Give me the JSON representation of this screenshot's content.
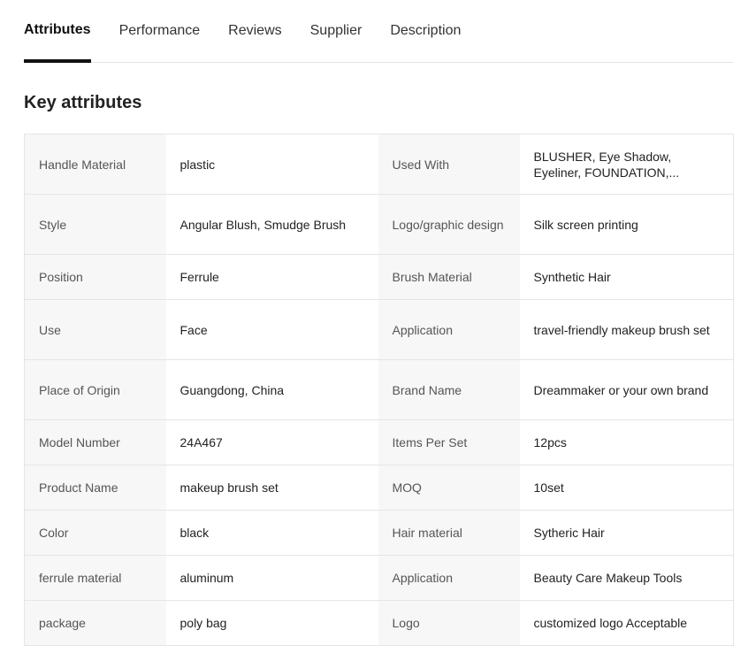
{
  "tabs": [
    {
      "label": "Attributes",
      "active": true
    },
    {
      "label": "Performance",
      "active": false
    },
    {
      "label": "Reviews",
      "active": false
    },
    {
      "label": "Supplier",
      "active": false
    },
    {
      "label": "Description",
      "active": false
    }
  ],
  "section_title": "Key attributes",
  "attributes": [
    {
      "k1": "Handle Material",
      "v1": "plastic",
      "k2": "Used With",
      "v2": "BLUSHER, Eye Shadow, Eyeliner, FOUNDATION,..."
    },
    {
      "k1": "Style",
      "v1": "Angular Blush, Smudge Brush",
      "k2": "Logo/graphic design",
      "v2": "Silk screen printing"
    },
    {
      "k1": "Position",
      "v1": "Ferrule",
      "k2": "Brush Material",
      "v2": "Synthetic Hair"
    },
    {
      "k1": "Use",
      "v1": "Face",
      "k2": "Application",
      "v2": "travel-friendly makeup brush set"
    },
    {
      "k1": "Place of Origin",
      "v1": "Guangdong, China",
      "k2": "Brand Name",
      "v2": "Dreammaker or your own brand"
    },
    {
      "k1": "Model Number",
      "v1": "24A467",
      "k2": "Items Per Set",
      "v2": "12pcs"
    },
    {
      "k1": "Product Name",
      "v1": "makeup brush set",
      "k2": "MOQ",
      "v2": "10set"
    },
    {
      "k1": "Color",
      "v1": "black",
      "k2": "Hair material",
      "v2": "Sytheric Hair"
    },
    {
      "k1": "ferrule material",
      "v1": "aluminum",
      "k2": "Application",
      "v2": "Beauty Care Makeup Tools"
    },
    {
      "k1": "package",
      "v1": "poly bag",
      "k2": "Logo",
      "v2": "customized logo Acceptable"
    }
  ]
}
